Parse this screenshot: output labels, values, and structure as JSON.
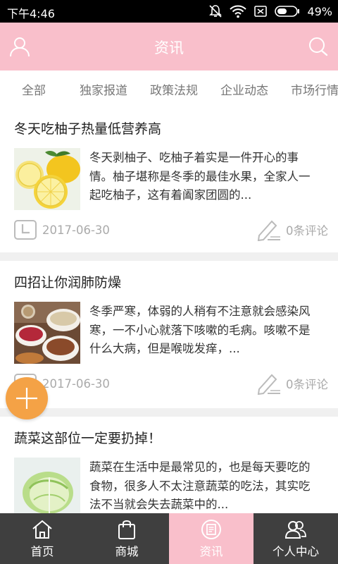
{
  "status_bar": {
    "time": "下午4:46",
    "battery": "49%",
    "icons": [
      "mute-icon",
      "wifi-icon",
      "sim-icon",
      "battery-icon"
    ]
  },
  "header": {
    "title": "资讯",
    "left_icon": "user-icon",
    "right_icon": "search-icon",
    "background": "#f9bfcb"
  },
  "tabs": [
    "全部",
    "独家报道",
    "政策法规",
    "企业动态",
    "市场行情"
  ],
  "articles": [
    {
      "title": "冬天吃柚子热量低营养高",
      "summary": "冬天剥柚子、吃柚子着实是一件开心的事情。柚子堪称是冬季的最佳水果，全家人一起吃柚子，这有着阖家团圆的...",
      "date": "2017-06-30",
      "comments": "0条评论",
      "image": "lemon-photo"
    },
    {
      "title": "四招让你润肺防燥",
      "summary": "冬季严寒，体弱的人稍有不注意就会感染风寒，一不小心就落下咳嗽的毛病。咳嗽不是什么大病，但是喉咙发痒，...",
      "date": "2017-06-30",
      "comments": "0条评论",
      "image": "tea-bowls-photo"
    },
    {
      "title": "蔬菜这部位一定要扔掉！",
      "summary": "蔬菜在生活中是最常见的，也是每天要吃的食物，很多人不太注意蔬菜的吃法，其实吃法不当就会失去蔬菜中的...",
      "date": "",
      "comments": "",
      "image": "cabbage-photo"
    }
  ],
  "bottom_nav": [
    {
      "label": "首页",
      "icon": "home-icon"
    },
    {
      "label": "商城",
      "icon": "shopping-bag-icon"
    },
    {
      "label": "资讯",
      "icon": "news-icon"
    },
    {
      "label": "个人中心",
      "icon": "people-icon"
    }
  ],
  "active_nav": "资讯",
  "fab_icon": "plus-icon",
  "colors": {
    "accent_pink": "#f9bfcb",
    "fab_orange": "#f4a246",
    "nav_dark": "#3f3f3f"
  }
}
